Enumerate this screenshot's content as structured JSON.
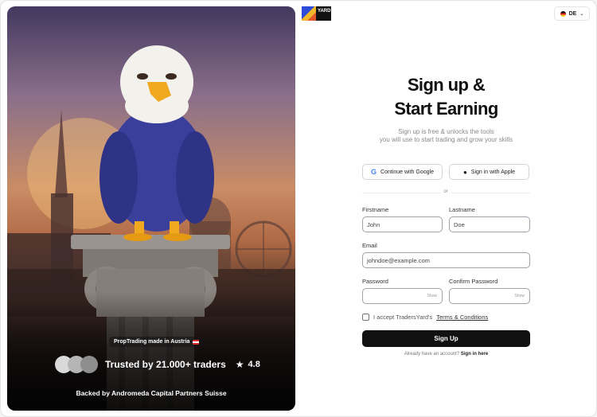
{
  "hero": {
    "made_in": "PropTrading made in Austria",
    "trusted": "Trusted by 21.000+ traders",
    "rating": "4.8",
    "backed": "Backed by Andromeda Capital Partners Suisse",
    "avatar_colors": [
      "#d9d9d9",
      "#b5b5b5",
      "#8e8e8e"
    ]
  },
  "header": {
    "logo_text": "YARD",
    "lang": "DE"
  },
  "form": {
    "title_line1": "Sign up &",
    "title_line2": "Start Earning",
    "subtitle_line1": "Sign up is free & unlocks the tools",
    "subtitle_line2": "you will use to start trading and grow your skills",
    "google_label": "Continue with Google",
    "apple_label": "Sign in with Apple",
    "or": "or",
    "firstname_label": "Firstname",
    "firstname_value": "John",
    "lastname_label": "Lastname",
    "lastname_value": "Doe",
    "email_label": "Email",
    "email_value": "johndoe@example.com",
    "password_label": "Password",
    "confirm_label": "Confirm Password",
    "show": "Show",
    "accept_text": "I accept TradersYard's",
    "terms": "Terms & Conditions",
    "signup": "Sign Up",
    "already": "Already have an account?",
    "signin": "Sign in here"
  }
}
